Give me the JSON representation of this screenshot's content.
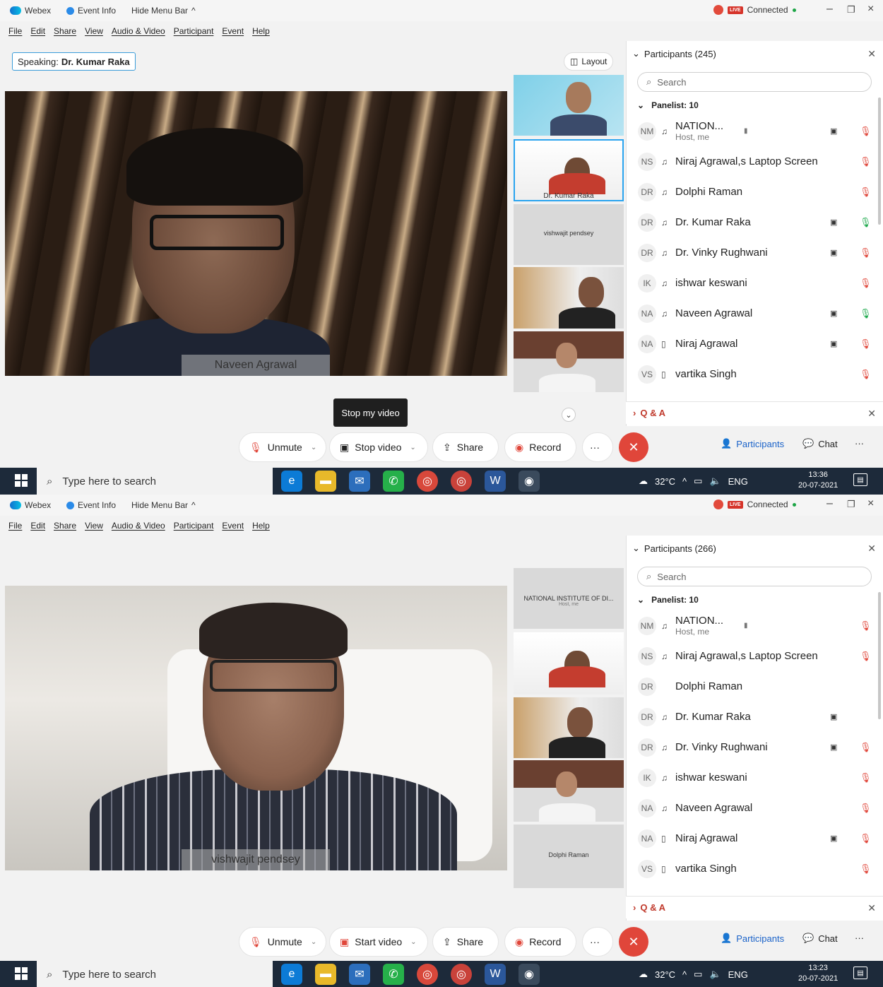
{
  "title_bar": {
    "app_name": "Webex",
    "event_info": "Event Info",
    "hide_menu": "Hide Menu Bar",
    "status": "Connected",
    "live_badge": "LIVE"
  },
  "menu": [
    "File",
    "Edit",
    "Share",
    "View",
    "Audio & Video",
    "Participant",
    "Event",
    "Help"
  ],
  "colors": {
    "accent": "#2aa4ef",
    "end_call": "#e0463a",
    "participants_blue": "#1b63c9",
    "qa_red": "#c0392b",
    "taskbar": "#1d2a3a"
  },
  "screen1": {
    "speaking_label": "Speaking:",
    "speaking_name": "Dr. Kumar Raka",
    "layout_label": "Layout",
    "main_name": "Naveen Agrawal",
    "tooltip": "Stop my video",
    "tiles": {
      "t2": "Dr. Kumar Raka",
      "t3": "vishwajit pendsey"
    },
    "participants_header": "Participants (245)",
    "search_placeholder": "Search",
    "panelist_header": "Panelist: 10",
    "participants": [
      {
        "initials": "NM",
        "name": "NATION...",
        "sub": "Host, me"
      },
      {
        "initials": "NS",
        "name": "Niraj Agrawal,s Laptop Screen"
      },
      {
        "initials": "DR",
        "name": "Dolphi Raman"
      },
      {
        "initials": "DR",
        "name": "Dr. Kumar Raka"
      },
      {
        "initials": "DR",
        "name": "Dr. Vinky Rughwani"
      },
      {
        "initials": "IK",
        "name": "ishwar keswani"
      },
      {
        "initials": "NA",
        "name": "Naveen Agrawal"
      },
      {
        "initials": "NA",
        "name": "Niraj Agrawal"
      },
      {
        "initials": "VS",
        "name": "vartika Singh"
      }
    ],
    "qa_label": "Q & A",
    "controls": {
      "unmute": "Unmute",
      "video": "Stop video",
      "share": "Share",
      "record": "Record",
      "more": "···",
      "participants": "Participants",
      "chat": "Chat"
    },
    "taskbar": {
      "search": "Type here to search",
      "temp": "32°C",
      "lang": "ENG",
      "time": "13:36",
      "date": "20-07-2021"
    }
  },
  "screen2": {
    "main_name": "vishwajit pendsey",
    "tiles": {
      "t1": "NATIONAL INSTITUTE OF DI...",
      "t1sub": "Host, me",
      "t5": "Dolphi Raman"
    },
    "participants_header": "Participants (266)",
    "search_placeholder": "Search",
    "panelist_header": "Panelist: 10",
    "participants": [
      {
        "initials": "NM",
        "name": "NATION...",
        "sub": "Host, me"
      },
      {
        "initials": "NS",
        "name": "Niraj Agrawal,s Laptop Screen"
      },
      {
        "initials": "DR",
        "name": "Dolphi Raman"
      },
      {
        "initials": "DR",
        "name": "Dr. Kumar Raka"
      },
      {
        "initials": "DR",
        "name": "Dr. Vinky Rughwani"
      },
      {
        "initials": "IK",
        "name": "ishwar keswani"
      },
      {
        "initials": "NA",
        "name": "Naveen Agrawal"
      },
      {
        "initials": "NA",
        "name": "Niraj Agrawal"
      },
      {
        "initials": "VS",
        "name": "vartika Singh"
      }
    ],
    "qa_label": "Q & A",
    "controls": {
      "unmute": "Unmute",
      "video": "Start video",
      "share": "Share",
      "record": "Record",
      "more": "···",
      "participants": "Participants",
      "chat": "Chat"
    },
    "taskbar": {
      "search": "Type here to search",
      "temp": "32°C",
      "lang": "ENG",
      "time": "13:23",
      "date": "20-07-2021"
    }
  }
}
